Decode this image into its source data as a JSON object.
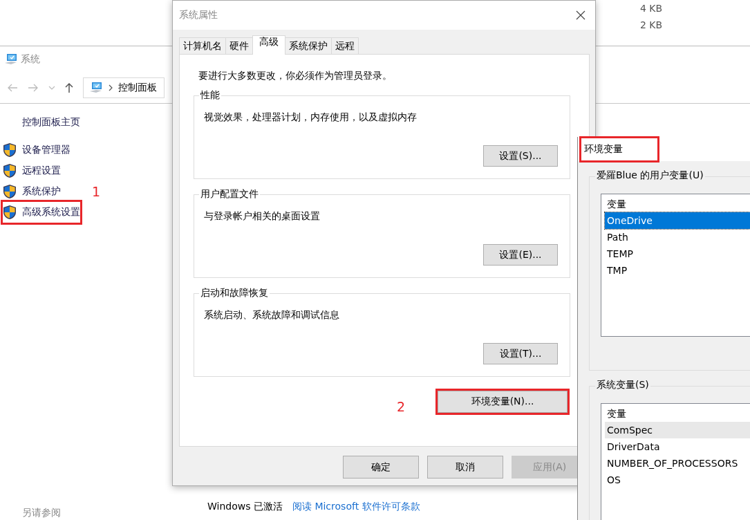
{
  "background_window": {
    "rows": [
      {
        "size": "4 KB"
      },
      {
        "size": "2 KB"
      }
    ]
  },
  "system_window": {
    "title": "系统",
    "breadcrumb": "控制面板",
    "sidebar": {
      "home": "控制面板主页",
      "items": [
        {
          "label": "设备管理器",
          "highlighted": false
        },
        {
          "label": "远程设置",
          "highlighted": false
        },
        {
          "label": "系统保护",
          "highlighted": false
        },
        {
          "label": "高级系统设置",
          "highlighted": true
        }
      ],
      "see_also": "另请参阅"
    },
    "activation": {
      "status": "Windows 已激活",
      "link": "阅读 Microsoft 软件许可条款"
    }
  },
  "system_properties": {
    "title": "系统属性",
    "tabs": [
      {
        "label": "计算机名",
        "selected": false
      },
      {
        "label": "硬件",
        "selected": false
      },
      {
        "label": "高级",
        "selected": true
      },
      {
        "label": "系统保护",
        "selected": false
      },
      {
        "label": "远程",
        "selected": false
      }
    ],
    "notice": "要进行大多数更改，你必须作为管理员登录。",
    "groups": [
      {
        "title": "性能",
        "description": "视觉效果，处理器计划，内存使用，以及虚拟内存",
        "button": "设置(S)..."
      },
      {
        "title": "用户配置文件",
        "description": "与登录帐户相关的桌面设置",
        "button": "设置(E)..."
      },
      {
        "title": "启动和故障恢复",
        "description": "系统启动、系统故障和调试信息",
        "button": "设置(T)..."
      }
    ],
    "env_button": {
      "label": "环境变量(N)...",
      "highlighted": true
    },
    "buttons": [
      {
        "label": "确定",
        "disabled": false
      },
      {
        "label": "取消",
        "disabled": false
      },
      {
        "label": "应用(A)",
        "disabled": true
      }
    ]
  },
  "env_dialog": {
    "title": "环境变量",
    "highlighted": true,
    "user_group": {
      "title": "爱羅Blue 的用户变量(U)",
      "column": "变量",
      "focused": true,
      "rows": [
        {
          "name": "OneDrive",
          "selected": true
        },
        {
          "name": "Path",
          "selected": false
        },
        {
          "name": "TEMP",
          "selected": false
        },
        {
          "name": "TMP",
          "selected": false
        }
      ]
    },
    "system_group": {
      "title": "系统变量(S)",
      "column": "变量",
      "focused": false,
      "rows": [
        {
          "name": "ComSpec",
          "selected": true
        },
        {
          "name": "DriverData",
          "selected": false
        },
        {
          "name": "NUMBER_OF_PROCESSORS",
          "selected": false
        },
        {
          "name": "OS",
          "selected": false
        }
      ]
    }
  },
  "annotations": [
    {
      "label": "1",
      "kind": "sidebar"
    },
    {
      "label": "2",
      "kind": "button"
    }
  ]
}
